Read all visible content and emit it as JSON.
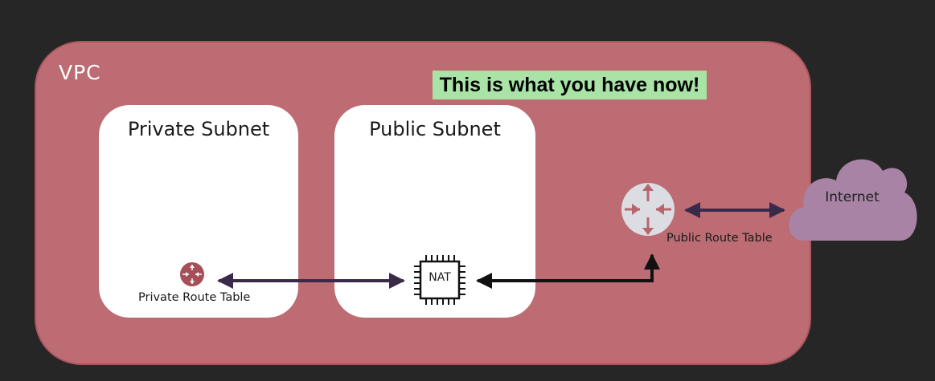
{
  "vpc": {
    "label": "VPC",
    "fill": "#bc6c72"
  },
  "banner": {
    "text": "This is what you have now!",
    "color": "#a9e4a6"
  },
  "subnets": {
    "private": {
      "title": "Private Subnet",
      "route_table_label": "Private Route Table"
    },
    "public": {
      "title": "Public Subnet",
      "nat_label": "NAT"
    }
  },
  "public_route_table": {
    "label": "Public Route Table"
  },
  "internet": {
    "label": "Internet",
    "fill": "#a883a5"
  },
  "icons": {
    "private_router": "router-icon",
    "public_router": "router-icon",
    "nat": "chip-icon",
    "internet": "cloud-icon"
  },
  "colors": {
    "arrow": "#3a2a4a",
    "router_private": "#a64f58",
    "router_public": "#dcdce3"
  }
}
